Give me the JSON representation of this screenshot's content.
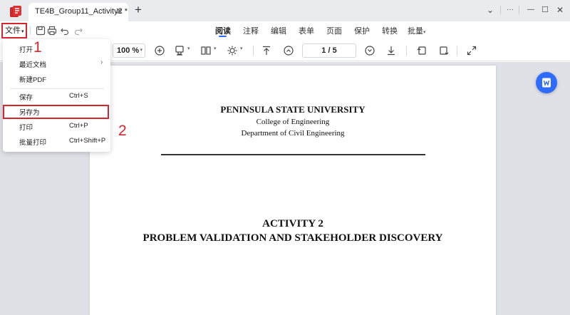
{
  "titlebar": {
    "tab_title": "TE4B_Group11_Activity2 *",
    "close_glyph": "✕",
    "new_tab_glyph": "+",
    "window_controls": [
      "⌄",
      "···",
      "—",
      "☐",
      "✕"
    ]
  },
  "menubar": {
    "file_label": "文件",
    "tabs": [
      {
        "label": "阅读",
        "active": true
      },
      {
        "label": "注释"
      },
      {
        "label": "编辑"
      },
      {
        "label": "表单"
      },
      {
        "label": "页面"
      },
      {
        "label": "保护"
      },
      {
        "label": "转换"
      },
      {
        "label": "批量"
      }
    ]
  },
  "toolbar": {
    "zoom": "100 %",
    "page_current": "1",
    "page_total": "5"
  },
  "file_menu": {
    "items": [
      {
        "label": "打开",
        "shortcut": ""
      },
      {
        "label": "最近文档",
        "shortcut": "",
        "submenu": true
      },
      {
        "label": "新建PDF",
        "shortcut": ""
      },
      {
        "label": "保存",
        "shortcut": "Ctrl+S"
      },
      {
        "label": "另存为",
        "shortcut": ""
      },
      {
        "label": "打印",
        "shortcut": "Ctrl+P"
      },
      {
        "label": "批量打印",
        "shortcut": "Ctrl+Shift+P"
      }
    ]
  },
  "document": {
    "university": "PENINSULA STATE UNIVERSITY",
    "college": "College of Engineering",
    "department": "Department of Civil Engineering",
    "activity": "ACTIVITY 2",
    "subtitle": "PROBLEM VALIDATION AND STAKEHOLDER DISCOVERY"
  },
  "annotations": {
    "step1": "1",
    "step2": "2"
  },
  "colors": {
    "accent": "#2e6bff",
    "annotation_red": "#d4262c"
  }
}
